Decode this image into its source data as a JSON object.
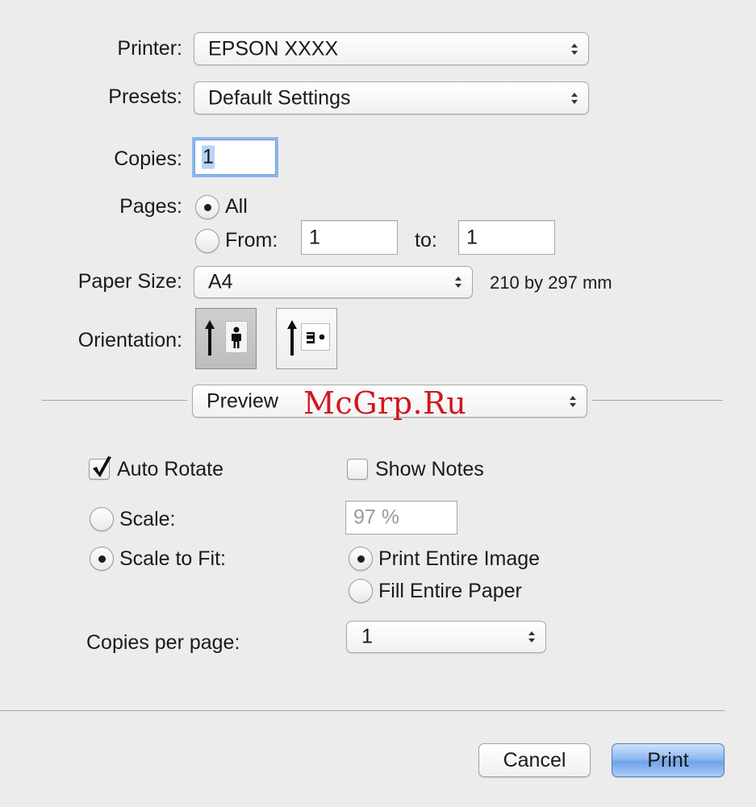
{
  "printer": {
    "label": "Printer:",
    "value": "EPSON XXXX"
  },
  "presets": {
    "label": "Presets:",
    "value": "Default Settings"
  },
  "copies": {
    "label": "Copies:",
    "value": "1"
  },
  "pages": {
    "label": "Pages:",
    "all_label": "All",
    "from_label": "From:",
    "from_value": "1",
    "to_label": "to:",
    "to_value": "1",
    "selected": "All"
  },
  "paper_size": {
    "label": "Paper Size:",
    "value": "A4",
    "dimensions": "210 by 297 mm"
  },
  "orientation": {
    "label": "Orientation:",
    "selected": "portrait"
  },
  "section_menu": {
    "value": "Preview"
  },
  "preview": {
    "auto_rotate": {
      "label": "Auto Rotate",
      "checked": true
    },
    "show_notes": {
      "label": "Show Notes",
      "checked": false
    },
    "scale": {
      "label": "Scale:",
      "value": "97 %"
    },
    "scale_to_fit": {
      "label": "Scale to Fit:"
    },
    "scale_mode_selected": "Scale to Fit:",
    "print_entire_image": {
      "label": "Print Entire Image"
    },
    "fill_entire_paper": {
      "label": "Fill Entire Paper"
    },
    "fit_mode_selected": "Print Entire Image",
    "copies_per_page": {
      "label": "Copies per page:",
      "value": "1"
    }
  },
  "buttons": {
    "cancel": "Cancel",
    "print": "Print"
  },
  "watermark": "McGrp.Ru"
}
